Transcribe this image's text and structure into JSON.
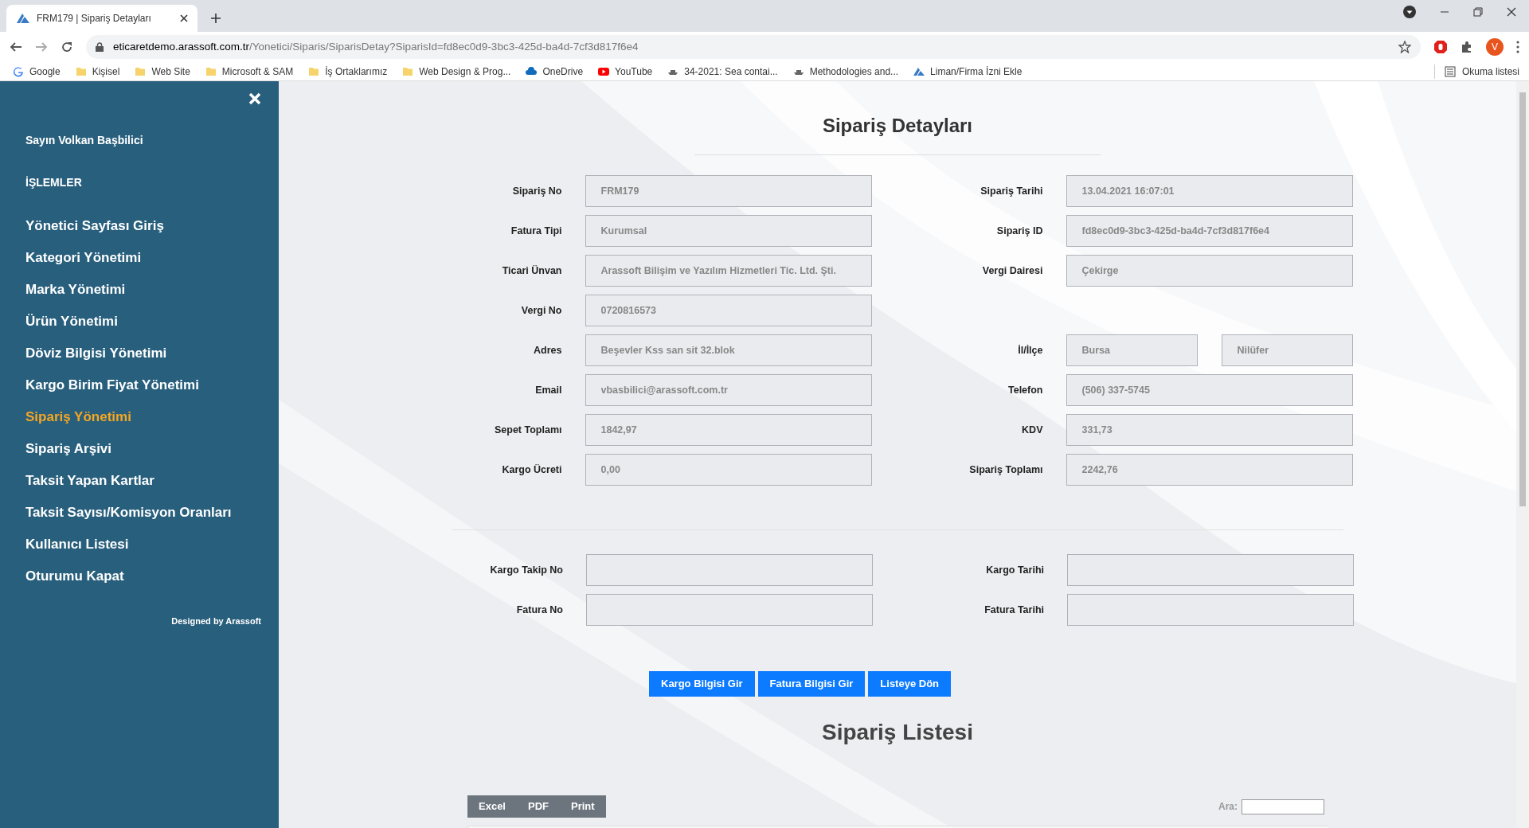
{
  "browser": {
    "tab_title": "FRM179 | Sipariş Detayları",
    "url_domain": "eticaretdemo.arassoft.com.tr",
    "url_path": "/Yonetici/Siparis/SiparisDetay?SiparisId=fd8ec0d9-3bc3-425d-ba4d-7cf3d817f6e4",
    "profile_initial": "V",
    "bookmarks": [
      {
        "label": "Google",
        "kind": "google"
      },
      {
        "label": "Kişisel",
        "kind": "folder"
      },
      {
        "label": "Web Site",
        "kind": "folder"
      },
      {
        "label": "Microsoft & SAM",
        "kind": "folder"
      },
      {
        "label": "İş Ortaklarımız",
        "kind": "folder"
      },
      {
        "label": "Web Design & Prog...",
        "kind": "folder"
      },
      {
        "label": "OneDrive",
        "kind": "cloud"
      },
      {
        "label": "YouTube",
        "kind": "youtube"
      },
      {
        "label": "34-2021: Sea contai...",
        "kind": "site"
      },
      {
        "label": "Methodologies and...",
        "kind": "site"
      },
      {
        "label": "Liman/Firma İzni Ekle",
        "kind": "logo"
      }
    ],
    "reading_list": "Okuma listesi"
  },
  "sidebar": {
    "greeting": "Sayın Volkan Başbilici",
    "section": "İŞLEMLER",
    "footer": "Designed by Arassoft",
    "items": [
      {
        "label": "Yönetici Sayfası Giriş",
        "selected": false
      },
      {
        "label": "Kategori Yönetimi",
        "selected": false
      },
      {
        "label": "Marka Yönetimi",
        "selected": false
      },
      {
        "label": "Ürün Yönetimi",
        "selected": false
      },
      {
        "label": "Döviz Bilgisi Yönetimi",
        "selected": false
      },
      {
        "label": "Kargo Birim Fiyat Yönetimi",
        "selected": false
      },
      {
        "label": "Sipariş Yönetimi",
        "selected": true
      },
      {
        "label": "Sipariş Arşivi",
        "selected": false
      },
      {
        "label": "Taksit Yapan Kartlar",
        "selected": false
      },
      {
        "label": "Taksit Sayısı/Komisyon Oranları",
        "selected": false
      },
      {
        "label": "Kullanıcı Listesi",
        "selected": false
      },
      {
        "label": "Oturumu Kapat",
        "selected": false
      }
    ]
  },
  "details": {
    "title": "Sipariş Detayları",
    "rows": [
      {
        "left": {
          "label": "Sipariş No",
          "values": [
            "FRM179"
          ]
        },
        "right": {
          "label": "Sipariş Tarihi",
          "values": [
            "13.04.2021 16:07:01"
          ]
        }
      },
      {
        "left": {
          "label": "Fatura Tipi",
          "values": [
            "Kurumsal"
          ]
        },
        "right": {
          "label": "Sipariş ID",
          "values": [
            "fd8ec0d9-3bc3-425d-ba4d-7cf3d817f6e4"
          ]
        }
      },
      {
        "left": {
          "label": "Ticari Ünvan",
          "values": [
            "Arassoft Bilişim ve Yazılım Hizmetleri Tic. Ltd. Şti."
          ]
        },
        "right": {
          "label": "Vergi Dairesi",
          "values": [
            "Çekirge"
          ]
        }
      },
      {
        "left": {
          "label": "Vergi No",
          "values": [
            "0720816573"
          ]
        }
      },
      {
        "left": {
          "label": "Adres",
          "values": [
            "Beşevler Kss san sit 32.blok"
          ]
        },
        "right": {
          "label": "İl/İlçe",
          "values": [
            "Bursa",
            "Nilüfer"
          ]
        }
      },
      {
        "left": {
          "label": "Email",
          "values": [
            "vbasbilici@arassoft.com.tr"
          ]
        },
        "right": {
          "label": "Telefon",
          "values": [
            "(506) 337-5745"
          ]
        }
      },
      {
        "left": {
          "label": "Sepet Toplamı",
          "values": [
            "1842,97"
          ]
        },
        "right": {
          "label": "KDV",
          "values": [
            "331,73"
          ]
        }
      },
      {
        "left": {
          "label": "Kargo Ücreti",
          "values": [
            "0,00"
          ]
        },
        "right": {
          "label": "Sipariş Toplamı",
          "values": [
            "2242,76"
          ]
        }
      }
    ],
    "shipping_rows": [
      {
        "left": {
          "label": "Kargo Takip No"
        },
        "right": {
          "label": "Kargo Tarihi"
        }
      },
      {
        "left": {
          "label": "Fatura No"
        },
        "right": {
          "label": "Fatura Tarihi"
        }
      }
    ],
    "buttons": [
      "Kargo Bilgisi Gir",
      "Fatura Bilgisi Gir",
      "Listeye Dön"
    ]
  },
  "order_list": {
    "title": "Sipariş Listesi",
    "export_buttons": [
      "Excel",
      "PDF",
      "Print"
    ],
    "search_label": "Ara:"
  }
}
